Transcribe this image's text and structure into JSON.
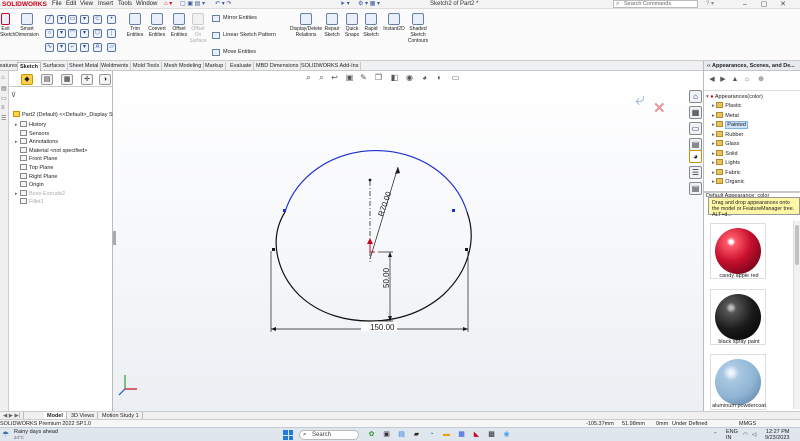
{
  "titlebar": {
    "logo": "SOLIDWORKS",
    "menus": [
      "File",
      "Edit",
      "View",
      "Insert",
      "Tools",
      "Window"
    ],
    "doc_title": "Sketch2 of Part2 *",
    "search_placeholder": "Search Commands",
    "window_buttons": [
      "–",
      "▢",
      "✕"
    ]
  },
  "command_manager": {
    "exit_sketch": "Exit Sketch",
    "smart_dimension": "Smart Dimension",
    "trim": "Trim Entities",
    "convert": "Convert Entities",
    "offset": "Offset Entities",
    "offset_surface": "Offset On Surface",
    "mirror": "Mirror Entities",
    "linear_pattern": "Linear Sketch Pattern",
    "move": "Move Entities",
    "display_delete": "Display/Delete Relations",
    "repair": "Repair Sketch",
    "quick_snaps": "Quick Snaps",
    "rapid_sketch": "Rapid Sketch",
    "instant2d": "Instant2D",
    "shaded_contours": "Shaded Sketch Contours"
  },
  "tabs": [
    "Features",
    "Sketch",
    "Surfaces",
    "Sheet Metal",
    "Weldments",
    "Mold Tools",
    "Mesh Modeling",
    "Markup",
    "Evaluate",
    "MBD Dimensions",
    "SOLIDWORKS Add-Ins"
  ],
  "active_tab": "Sketch",
  "feature_tree": {
    "root": "Part2 (Default) <<Default>_Display St",
    "items": [
      {
        "label": "History",
        "expander": true,
        "greyed": false
      },
      {
        "label": "Sensors",
        "expander": false,
        "greyed": false
      },
      {
        "label": "Annotations",
        "expander": true,
        "greyed": false
      },
      {
        "label": "Material <not specified>",
        "expander": false,
        "greyed": false
      },
      {
        "label": "Front Plane",
        "expander": false,
        "greyed": false
      },
      {
        "label": "Top Plane",
        "expander": false,
        "greyed": false
      },
      {
        "label": "Right Plane",
        "expander": false,
        "greyed": false
      },
      {
        "label": "Origin",
        "expander": false,
        "greyed": false
      },
      {
        "label": "Boss-Extrude2",
        "expander": true,
        "greyed": true
      },
      {
        "label": "Fillet1",
        "expander": false,
        "greyed": true
      }
    ]
  },
  "sketch": {
    "dim_radius": "R70.00",
    "dim_height": "50.00",
    "dim_width": "150.00",
    "arc_color": "#1f2fd6",
    "line_color": "#111111"
  },
  "task_pane": {
    "header": "Appearances, Scenes, and De...",
    "root": "Appearances(color)",
    "items": [
      {
        "label": "Plastic",
        "selected": false
      },
      {
        "label": "Metal",
        "selected": false
      },
      {
        "label": "Painted",
        "selected": true
      },
      {
        "label": "Rubber",
        "selected": false
      },
      {
        "label": "Glass",
        "selected": false
      },
      {
        "label": "Solid",
        "selected": false
      },
      {
        "label": "Lights",
        "selected": false
      },
      {
        "label": "Fabric",
        "selected": false
      },
      {
        "label": "Organic",
        "selected": false
      }
    ],
    "default_appearance": "Default Appearance: color",
    "tooltip": "Drag and drop appearances onto the model or FeatureManager tree.  ALT+d...",
    "swatches": [
      {
        "label": "candy apple red",
        "color": "#c8102e"
      },
      {
        "label": "black spray paint",
        "color": "#1a1a1a"
      },
      {
        "label": "aluminum powdercoat",
        "color": "#8fb4d4"
      }
    ]
  },
  "bottom_tabs": [
    "Model",
    "3D Views",
    "Motion Study 1"
  ],
  "status": {
    "product": "SOLIDWORKS Premium 2022 SP1.0",
    "x": "-105.37mm",
    "y": "51.98mm",
    "z": "0mm",
    "state": "Under Defined",
    "units": "MMGS"
  },
  "taskbar": {
    "weather": "Rainy days ahead",
    "weather_sub": "24°C",
    "search": "Search",
    "lang": "ENG",
    "region": "IN",
    "time": "12:27 PM",
    "date": "9/23/2023"
  }
}
